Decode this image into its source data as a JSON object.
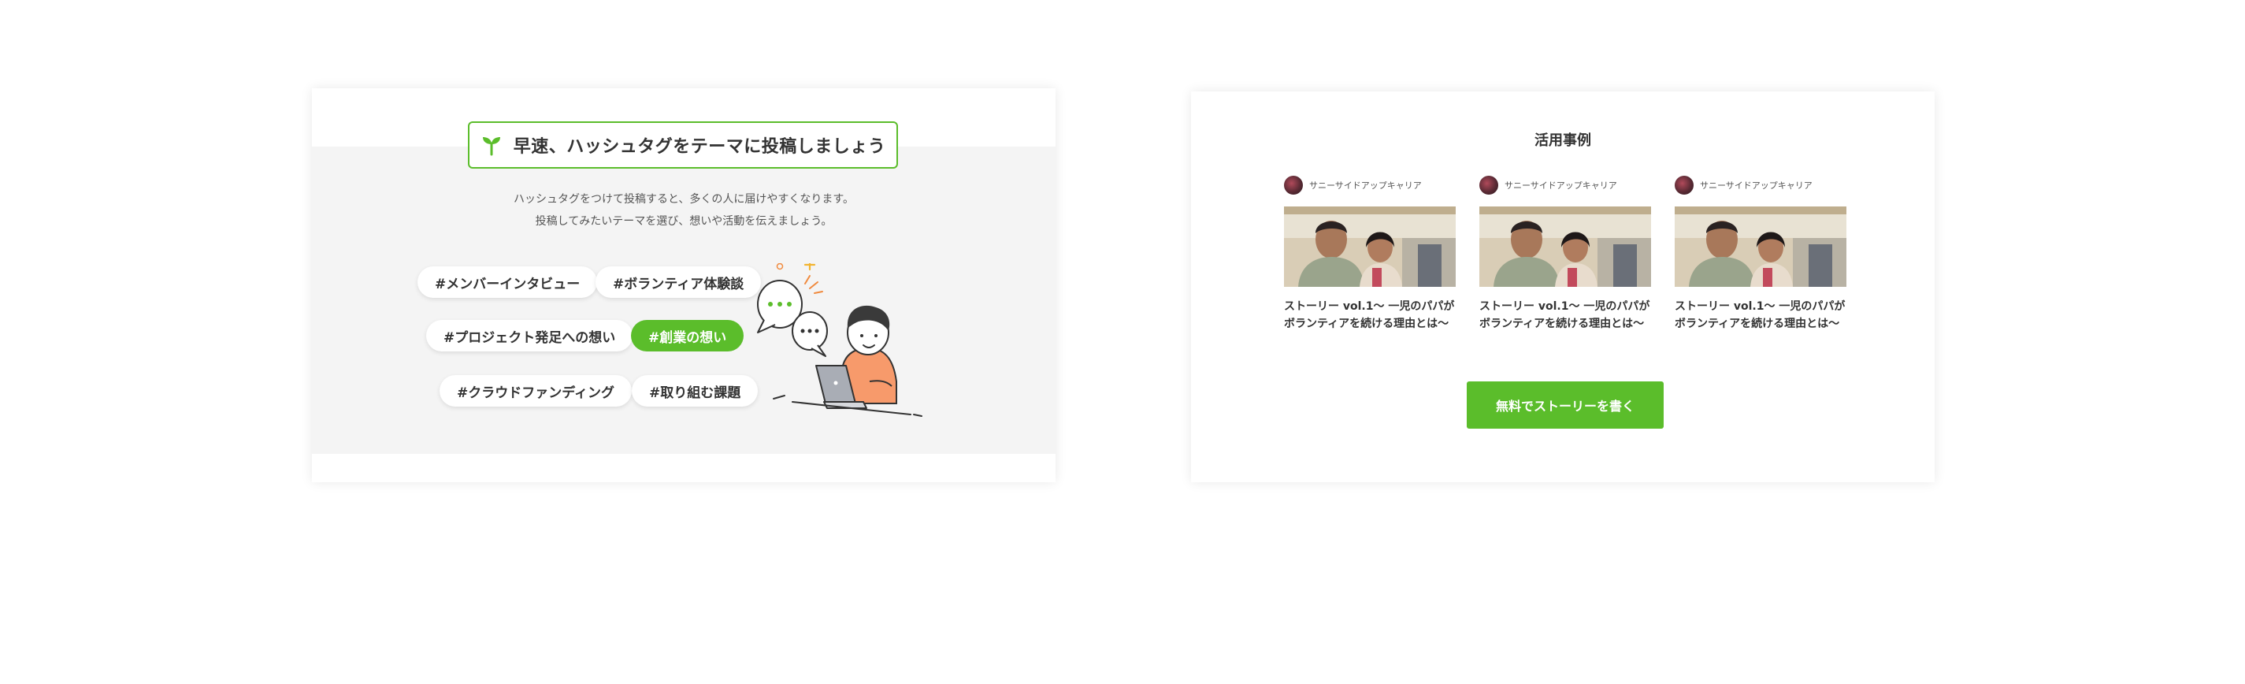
{
  "hashtag_section": {
    "headline": "早速、ハッシュタグをテーマに投稿しましょう",
    "description_line1": "ハッシュタグをつけて投稿すると、多くの人に届けやすくなります。",
    "description_line2": "投稿してみたいテーマを選び、想いや活動を伝えましょう。",
    "tags": [
      {
        "label": "#メンバーインタビュー",
        "active": false
      },
      {
        "label": "#ボランティア体験談",
        "active": false
      },
      {
        "label": "#プロジェクト発足への想い",
        "active": false
      },
      {
        "label": "#創業の想い",
        "active": true
      },
      {
        "label": "#クラウドファンディング",
        "active": false
      },
      {
        "label": "#取り組む課題",
        "active": false
      }
    ],
    "accent_color": "#5bbd2b"
  },
  "examples_section": {
    "title": "活用事例",
    "stories": [
      {
        "author": "サニーサイドアップキャリア",
        "title_line1": "ストーリー vol.1〜 一児のパパが",
        "title_line2": "ボランティアを続ける理由とは〜"
      },
      {
        "author": "サニーサイドアップキャリア",
        "title_line1": "ストーリー vol.1〜 一児のパパが",
        "title_line2": "ボランティアを続ける理由とは〜"
      },
      {
        "author": "サニーサイドアップキャリア",
        "title_line1": "ストーリー vol.1〜 一児のパパが",
        "title_line2": "ボランティアを続ける理由とは〜"
      }
    ],
    "cta_label": "無料でストーリーを書く"
  }
}
